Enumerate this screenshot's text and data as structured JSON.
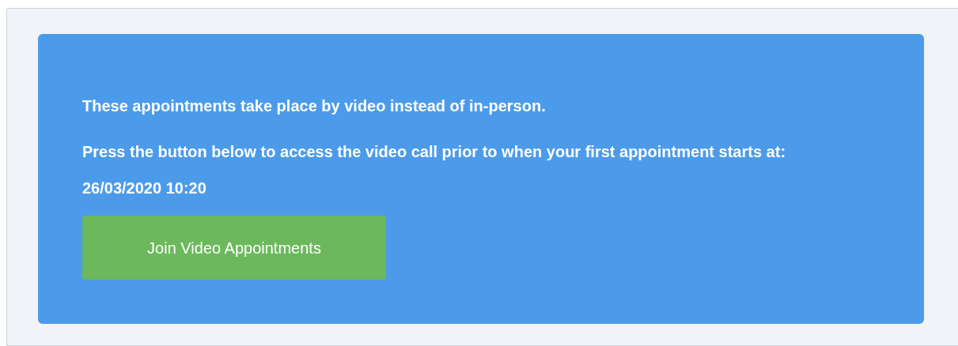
{
  "notice": {
    "paragraphs": [
      "These appointments take place by video instead of in-person.",
      "Press the button below to access the video call prior to when your first appointment starts at: 26/03/2020 10:20"
    ],
    "button": {
      "label": "Join Video Appointments"
    }
  }
}
